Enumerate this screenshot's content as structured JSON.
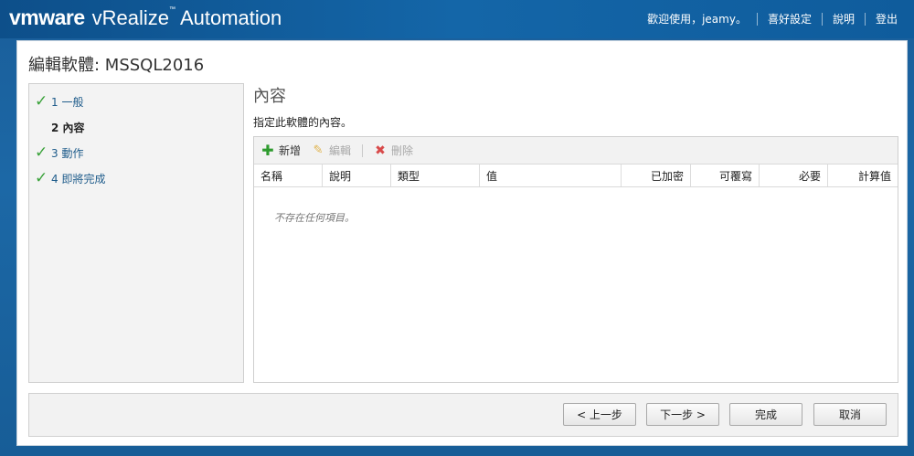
{
  "header": {
    "brand": "vmware",
    "product": "vRealize",
    "product_suffix": "Automation",
    "welcome": "歡迎使用，jeamy。",
    "preferences": "喜好設定",
    "help": "說明",
    "logout": "登出"
  },
  "page": {
    "title": "編輯軟體: MSSQL2016"
  },
  "steps": [
    {
      "label": "1 一般",
      "completed": true
    },
    {
      "label": "2 內容",
      "completed": false,
      "current": true
    },
    {
      "label": "3 動作",
      "completed": true
    },
    {
      "label": "4 即將完成",
      "completed": true
    }
  ],
  "content": {
    "title": "內容",
    "description": "指定此軟體的內容。",
    "toolbar": {
      "add": "新增",
      "edit": "編輯",
      "delete": "刪除"
    },
    "columns": [
      "名稱",
      "說明",
      "類型",
      "值",
      "已加密",
      "可覆寫",
      "必要",
      "計算值"
    ],
    "empty_message": "不存在任何項目。"
  },
  "footer": {
    "previous": "< 上一步",
    "next": "下一步 >",
    "finish": "完成",
    "cancel": "取消"
  },
  "colors": {
    "accent": "#1466a8",
    "check": "#3aa23a",
    "add": "#2e9b2e",
    "delete": "#d84a4a"
  }
}
